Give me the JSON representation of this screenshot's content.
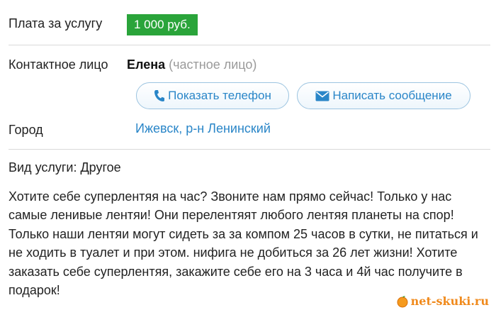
{
  "service_fee": {
    "label": "Плата за услугу",
    "price": "1 000 руб."
  },
  "contact": {
    "label": "Контактное лицо",
    "name": "Елена",
    "type": "(частное лицо)",
    "phone_button": "Показать телефон",
    "message_button": "Написать сообщение"
  },
  "city": {
    "label": "Город",
    "value": "Ижевск, р-н Ленинский"
  },
  "service_type": "Вид услуги: Другое",
  "description": "Хотите себе суперлентяя на час? Звоните нам прямо сейчас! Только у нас самые ленивые лентяи! Они перелентяят любого лентяя планеты на спор! Только наши лентяи могут сидеть за за компом 25 часов в сутки, не питаться и не ходить в туалет и при этом. нифига не добиться за 26 лет жизни! Хотите заказать себе суперлентяя, закажите себе его на 3 часа и 4й час получите в подарок!",
  "watermark": "net-skuki.ru",
  "colors": {
    "price_bg": "#2aa43a",
    "link": "#2a86c8",
    "button_border": "#9cc4e0"
  },
  "icons": {
    "phone": "phone-icon",
    "message": "envelope-icon",
    "watermark": "orange-fruit-icon"
  }
}
